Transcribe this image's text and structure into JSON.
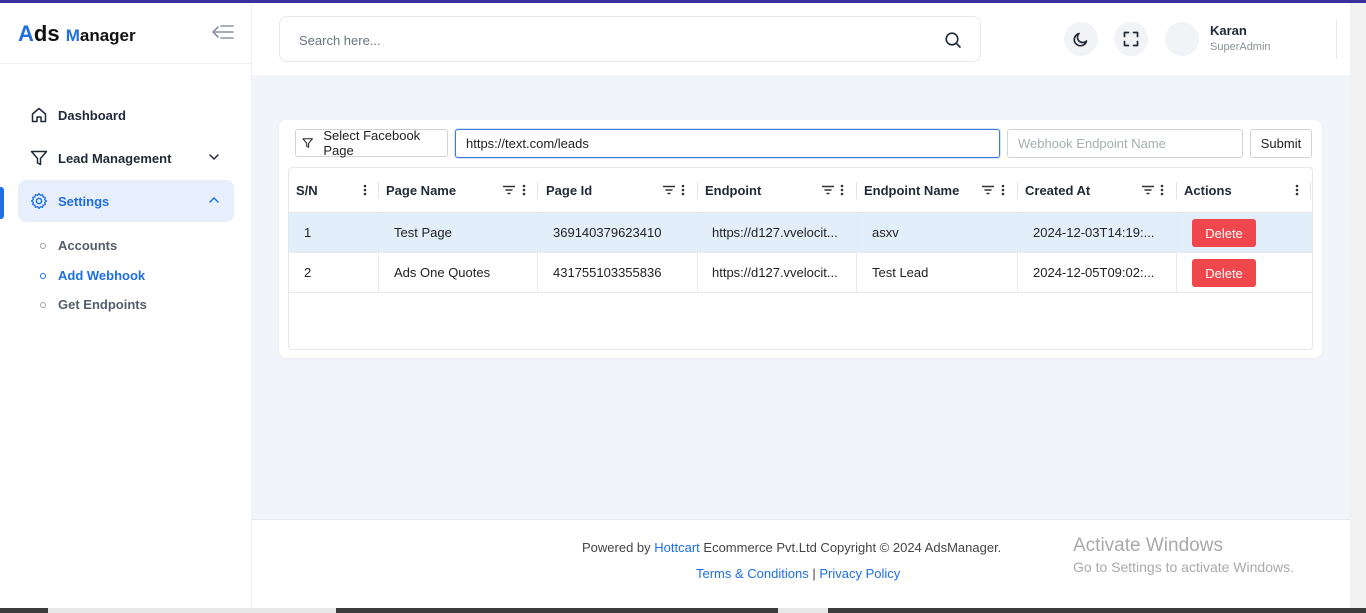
{
  "brand": {
    "letter_a": "A",
    "ds": "ds",
    "letter_m": "M",
    "rest": "anager"
  },
  "sidebar": {
    "nav": [
      {
        "label": "Dashboard"
      },
      {
        "label": "Lead Management"
      },
      {
        "label": "Settings"
      }
    ],
    "sub": [
      {
        "label": "Accounts"
      },
      {
        "label": "Add Webhook"
      },
      {
        "label": "Get Endpoints"
      }
    ]
  },
  "header": {
    "search_placeholder": "Search here...",
    "user_name": "Karan",
    "user_role": "SuperAdmin"
  },
  "form": {
    "select_page_label": "Select Facebook Page",
    "url_value": "https://text.com/leads",
    "endpoint_name_placeholder": "Webhook Endpoint Name",
    "submit_label": "Submit"
  },
  "table": {
    "columns": [
      "S/N",
      "Page Name",
      "Page Id",
      "Endpoint",
      "Endpoint Name",
      "Created At",
      "Actions"
    ],
    "rows": [
      {
        "sn": "1",
        "page_name": "Test Page",
        "page_id": "369140379623410",
        "endpoint": "https://d127.vvelocit...",
        "endpoint_name": "asxv",
        "created_at": "2024-12-03T14:19:...",
        "action": "Delete"
      },
      {
        "sn": "2",
        "page_name": "Ads One Quotes",
        "page_id": "431755103355836",
        "endpoint": "https://d127.vvelocit...",
        "endpoint_name": "Test Lead",
        "created_at": "2024-12-05T09:02:...",
        "action": "Delete"
      }
    ]
  },
  "footer": {
    "powered_prefix": "Powered by ",
    "powered_link": "Hottcart",
    "powered_suffix": " Ecommerce Pvt.Ltd Copyright © 2024 AdsManager.",
    "terms": "Terms & Conditions",
    "separator": "|",
    "privacy": "Privacy Policy"
  },
  "watermark": {
    "line1": "Activate Windows",
    "line2": "Go to Settings to activate Windows."
  },
  "colors": {
    "accent": "#1f6fe5",
    "danger": "#f0474d",
    "selected_row": "#e3eefb"
  }
}
